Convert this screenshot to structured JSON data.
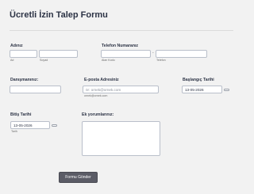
{
  "form": {
    "title": "Ücretli İzin Talep Formu",
    "submit_label": "Formu Gönder"
  },
  "fields": {
    "name": {
      "label": "Adınız",
      "first_sub": "Ad",
      "last_sub": "Soyad",
      "first_value": "",
      "last_value": ""
    },
    "phone": {
      "label": "Telefon Numaranız",
      "area_sub": "Alan Kodu",
      "number_sub": "Telefon",
      "separator": "-",
      "area_value": "",
      "number_value": ""
    },
    "advisor": {
      "label": "Danışmanınız:",
      "value": ""
    },
    "email": {
      "label": "E-posta Adresiniz",
      "placeholder": "ör: ornek@ornek.com",
      "sub": "ornek@ornek.com",
      "value": ""
    },
    "start_date": {
      "label": "Başlangıç Tarihi",
      "value": "13-05-2026"
    },
    "end_date": {
      "label": "Bitiş Tarihi",
      "value": "13-05-2026",
      "sub": "Tarih"
    },
    "comments": {
      "label": "Ek yorumlarınız:",
      "value": ""
    }
  },
  "icons": {
    "calendar": "calendar-icon"
  }
}
